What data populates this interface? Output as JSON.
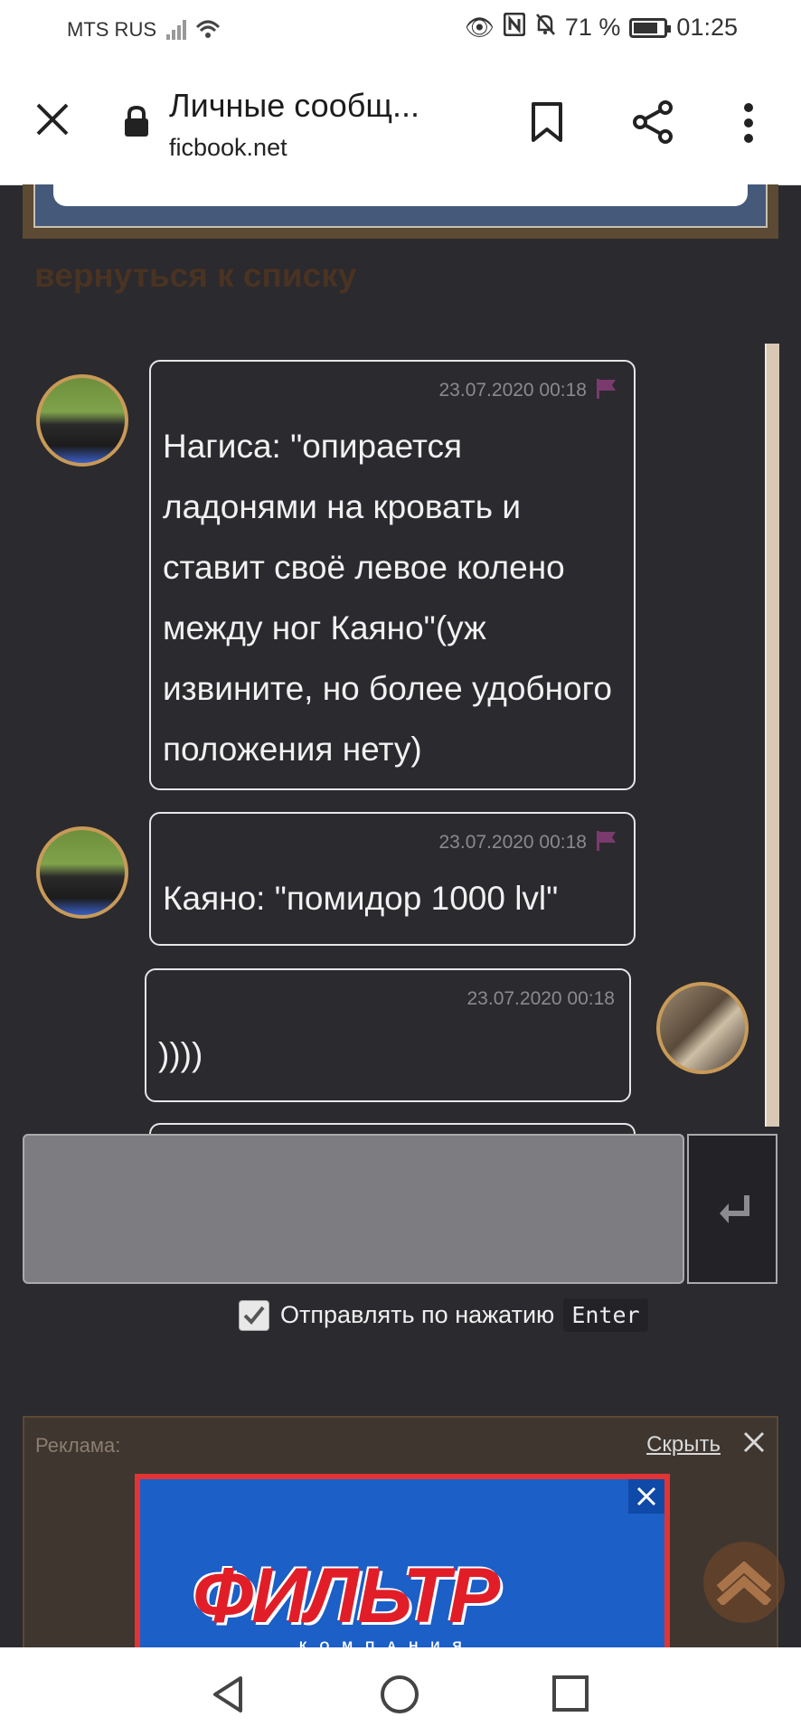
{
  "status_bar": {
    "carrier": "MTS RUS",
    "battery": "71 %",
    "time": "01:25"
  },
  "browser": {
    "title": "Личные сообщ...",
    "url": "ficbook.net"
  },
  "page": {
    "back_link": "вернуться к списку"
  },
  "messages": [
    {
      "timestamp": "23.07.2020 00:18",
      "text": "Нагиса: \"опирается ладонями на кровать и ставит своё левое колено между ног Каяно\"(уж извините, но более удобного положения нету)",
      "side": "left",
      "flag": true
    },
    {
      "timestamp": "23.07.2020 00:18",
      "text": "Каяно: \"помидор 1000 lvl\"",
      "side": "left",
      "flag": true
    },
    {
      "timestamp": "23.07.2020 00:18",
      "text": "))))",
      "side": "right",
      "flag": false
    }
  ],
  "composer": {
    "send_on_enter_label": "Отправлять по нажатию",
    "enter_key": "Enter",
    "send_on_enter_checked": true
  },
  "ad": {
    "label": "Реклама:",
    "hide_label": "Скрыть",
    "brand": "ФИЛЬТР",
    "brand_sub": "КОМПАНИЯ"
  },
  "colors": {
    "page_bg": "#2b2a2e",
    "avatar_border": "#c89a58",
    "flag": "#7a3a6e",
    "back_link": "#4a3322"
  }
}
